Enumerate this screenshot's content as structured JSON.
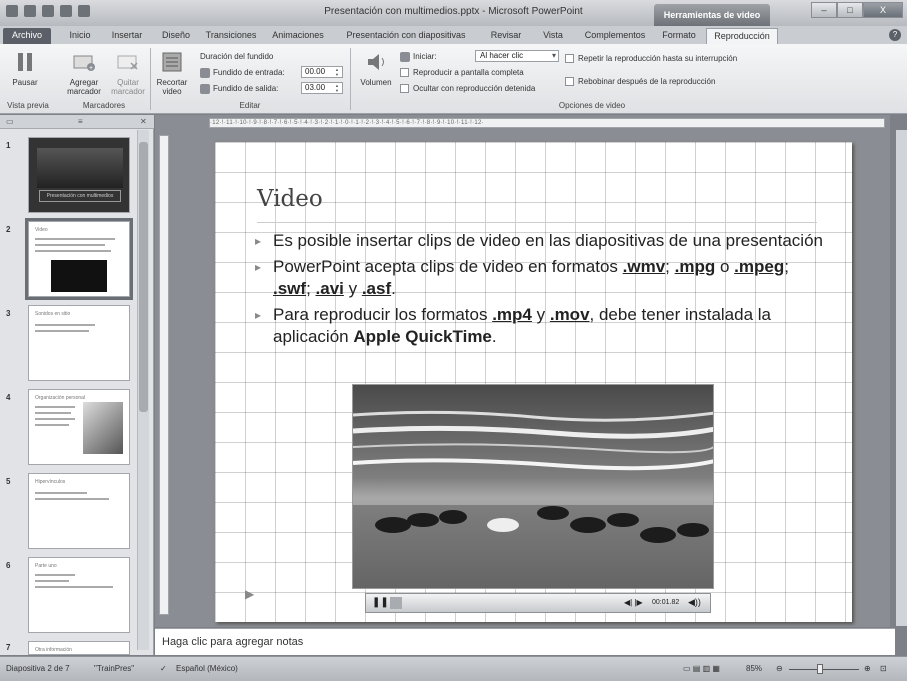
{
  "window": {
    "title": "Presentación con multimedios.pptx - Microsoft PowerPoint",
    "context_tab": "Herramientas de video",
    "minimize": "–",
    "maximize": "□",
    "close": "X"
  },
  "tabs": [
    "Archivo",
    "Inicio",
    "Insertar",
    "Diseño",
    "Transiciones",
    "Animaciones",
    "Presentación con diapositivas",
    "Revisar",
    "Vista",
    "Complementos",
    "Formato",
    "Reproducción"
  ],
  "ribbon": {
    "pausar": "Pausar",
    "agregar_marcador": "Agregar marcador",
    "quitar_marcador": "Quitar marcador",
    "recortar_video": "Recortar video",
    "duracion_fundido": "Duración del fundido",
    "fundido_entrada": "Fundido de entrada:",
    "fundido_entrada_val": "00.00",
    "fundido_salida": "Fundido de salida:",
    "fundido_salida_val": "03.00",
    "volumen": "Volumen",
    "iniciar": "Iniciar:",
    "iniciar_val": "Al hacer clic",
    "reproducir_pantalla": "Reproducir a pantalla completa",
    "ocultar": "Ocultar con reproducción detenida",
    "repetir": "Repetir la reproducción hasta su interrupción",
    "rebobinar": "Rebobinar después de la reproducción",
    "groups": {
      "vista_previa": "Vista previa",
      "marcadores": "Marcadores",
      "editar": "Editar",
      "opciones": "Opciones de video"
    }
  },
  "thumbnails": [
    {
      "num": "1",
      "title": "Presentación con multimedios"
    },
    {
      "num": "2",
      "title": "Video"
    },
    {
      "num": "3",
      "title": "Sonidos en sitio"
    },
    {
      "num": "4",
      "title": "Organización personal"
    },
    {
      "num": "5",
      "title": "Hipervínculos"
    },
    {
      "num": "6",
      "title": "Parte uno"
    },
    {
      "num": "7",
      "title": "Otra información"
    }
  ],
  "ruler": "·12·!·11·!·10·!·9·!·8·!·7·!·6·!·5·!·4·!·3·!·2·!·1·!·0·!·1·!·2·!·3·!·4·!·5·!·6·!·7·!·8·!·9·!·10·!·11·!·12·",
  "slide": {
    "title": "Video",
    "bullet1": "Es posible insertar clips de video en las diapositivas de una presentación",
    "bullet2_pre": "PowerPoint acepta clips de video en formatos ",
    "wmv": ".wmv",
    "sep1": "; ",
    "mpg": ".mpg",
    "o": " o ",
    "mpeg": ".mpeg",
    "sep2": "; ",
    "swf": ".swf",
    "sep3": "; ",
    "avi": ".avi",
    "y1": " y ",
    "asf": ".asf",
    "end2": ".",
    "bullet3_pre": "Para reproducir los formatos ",
    "mp4": ".mp4",
    "y2": " y ",
    "mov": ".mov",
    "bullet3_mid": ", debe tener instalada la aplicación ",
    "apple": "Apple QuickTime",
    "end3": "."
  },
  "video_controls": {
    "time": "00:01.82"
  },
  "notes_placeholder": "Haga clic para agregar notas",
  "status": {
    "slide_of": "Diapositiva 2 de 7",
    "theme": "\"TrainPres\"",
    "language": "Español (México)",
    "zoom": "85%"
  }
}
